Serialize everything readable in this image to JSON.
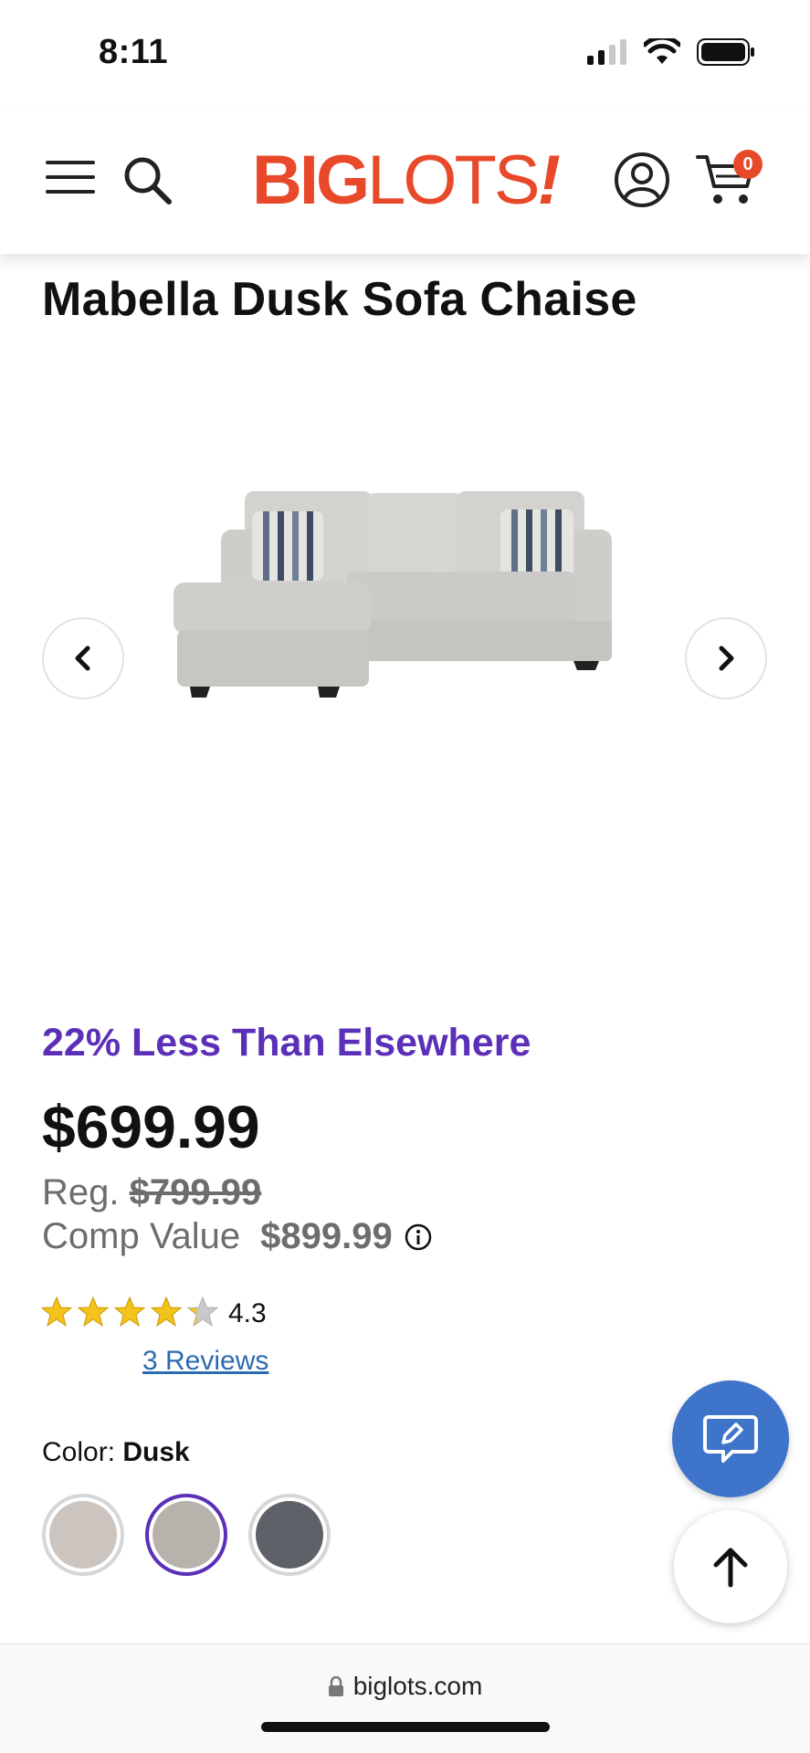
{
  "status_bar": {
    "time": "8:11"
  },
  "header": {
    "logo_big": "BIG",
    "logo_lots": "LOTS",
    "logo_bang": "!",
    "cart_count": "0",
    "brand_color": "#e8492a"
  },
  "product": {
    "title": "Mabella Dusk Sofa Chaise",
    "image_alt": "sofa-chaise-image",
    "savings_text": "22% Less Than Elsewhere",
    "price": "$699.99",
    "reg_label": "Reg.",
    "reg_price": "$799.99",
    "comp_label": "Comp Value",
    "comp_price": "$899.99",
    "rating": 4.3,
    "rating_text": "4.3",
    "reviews_text": "3 Reviews",
    "color_label": "Color:",
    "color_value": "Dusk",
    "swatches": [
      {
        "color": "#cbc4bf",
        "selected": false
      },
      {
        "color": "#b8b2ad",
        "selected": true
      },
      {
        "color": "#5f6168",
        "selected": false
      }
    ],
    "accent_color": "#5b2fb8"
  },
  "browser": {
    "url": "biglots.com"
  }
}
